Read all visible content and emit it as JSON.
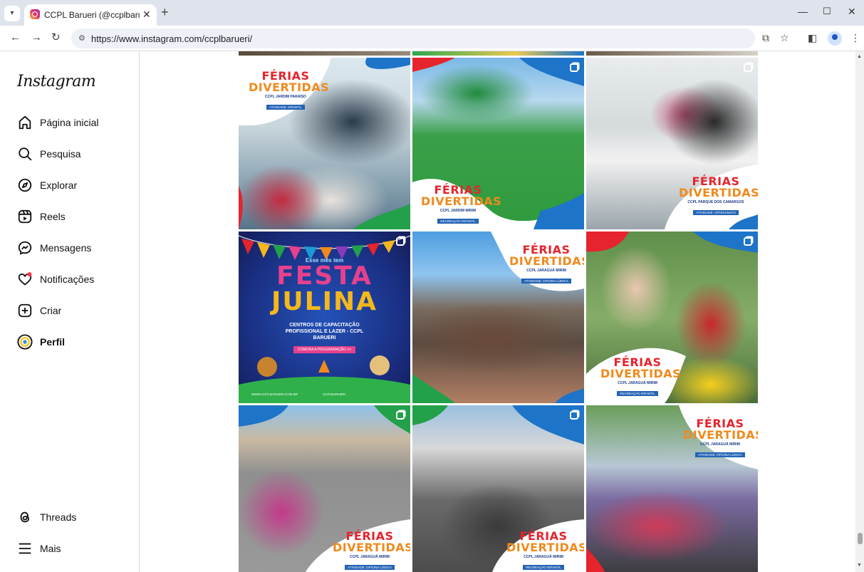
{
  "browser": {
    "tab_title": "CCPL Barueri (@ccplbarueri) • I",
    "url": "https://www.instagram.com/ccplbarueri/",
    "icons": [
      "tab-search-icon",
      "close-icon",
      "new-tab-icon",
      "minimize-icon",
      "maximize-icon",
      "window-close-icon",
      "back-icon",
      "forward-icon",
      "reload-icon",
      "site-info-icon",
      "cast-icon",
      "star-icon",
      "side-panel-icon",
      "profile-icon",
      "menu-icon"
    ]
  },
  "sidebar": {
    "logo": "Instagram",
    "items": [
      {
        "label": "Página inicial",
        "icon": "home-icon"
      },
      {
        "label": "Pesquisa",
        "icon": "search-icon"
      },
      {
        "label": "Explorar",
        "icon": "compass-icon"
      },
      {
        "label": "Reels",
        "icon": "reels-icon"
      },
      {
        "label": "Mensagens",
        "icon": "messenger-icon"
      },
      {
        "label": "Notificações",
        "icon": "heart-icon"
      },
      {
        "label": "Criar",
        "icon": "plus-square-icon"
      },
      {
        "label": "Perfil",
        "icon": "avatar-icon"
      }
    ],
    "bottom": [
      {
        "label": "Threads",
        "icon": "threads-icon"
      },
      {
        "label": "Mais",
        "icon": "hamburger-icon"
      }
    ]
  },
  "posts": [
    {
      "w1": "FÉRIAS",
      "w2": "DIVERTIDAS",
      "sub": "CCPL JARDIM PARAÍSO",
      "tag": "ATIVIDADE: INFANTIL"
    },
    {
      "w1": "FÉRIAS",
      "w2": "DIVERTIDAS",
      "sub": "CCPL JARDIM MIRIM",
      "tag": "RECREAÇÃO INFANTIL"
    },
    {
      "w1": "FÉRIAS",
      "w2": "DIVERTIDAS",
      "sub": "CCPL PARQUE DOS CAMARGOS",
      "tag": "ATIVIDADE: ARTESANATO"
    },
    {
      "kicker": "Esse mês tem",
      "title1": "FESTA",
      "title2": "JULINA",
      "sub": "CENTROS DE CAPACITAÇÃO PROFISSIONAL E LAZER - CCPL BARUERI",
      "cta": "CONFIRA A PROGRAMAÇÃO >>",
      "site": "WWW.CCPLBARUERI.COM.BR",
      "handle": "CCPLBARUERI"
    },
    {
      "w1": "FÉRIAS",
      "w2": "DIVERTIDAS",
      "sub": "CCPL JARAGUÁ MIRIM",
      "tag": "ATIVIDADE: OFICINA LÚDICA"
    },
    {
      "w1": "FÉRIAS",
      "w2": "DIVERTIDAS",
      "sub": "CCPL JARAGUÁ MIRIM",
      "tag": "RECREAÇÃO INFANTIL"
    },
    {
      "w1": "FÉRIAS",
      "w2": "DIVERTIDAS",
      "sub": "CCPL JARAGUÁ MIRIM",
      "tag": "ATIVIDADE: OFICINA LÚDICA"
    },
    {
      "w1": "FÉRIAS",
      "w2": "DIVERTIDAS",
      "sub": "CCPL JARAGUÁ MIRIM",
      "tag": "RECREAÇÃO INFANTIL"
    },
    {
      "w1": "FÉRIAS",
      "w2": "DIVERTIDAS",
      "sub": "CCPL JARAGUÁ MIRIM",
      "tag": "ATIVIDADE: OFICINA LÚDICA"
    }
  ]
}
